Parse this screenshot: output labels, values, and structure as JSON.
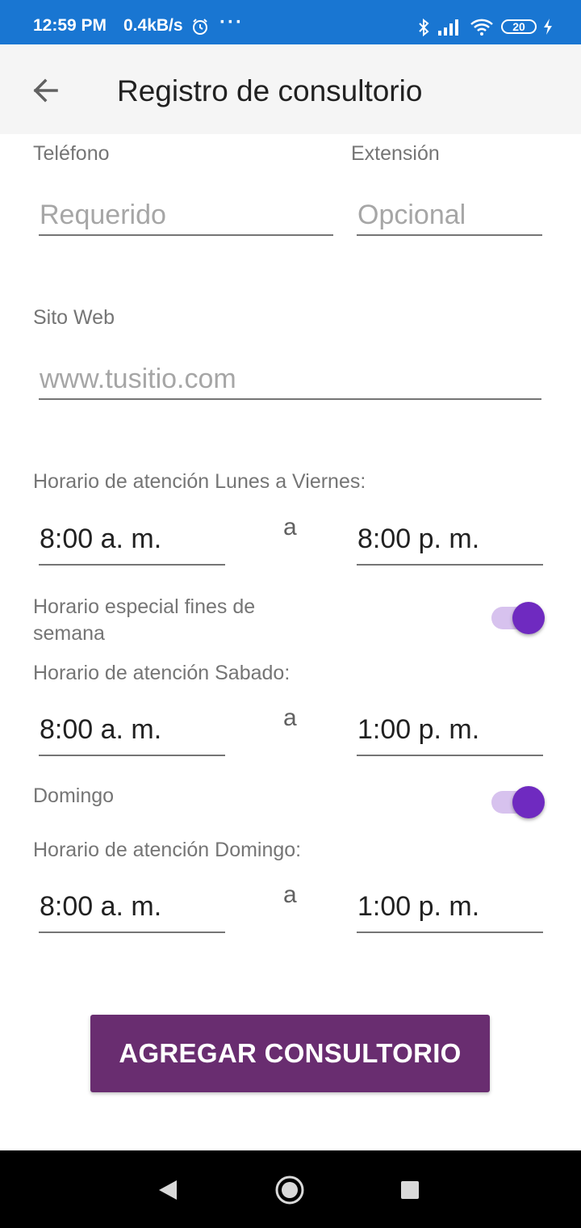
{
  "status_bar": {
    "time": "12:59 PM",
    "network_speed": "0.4kB/s",
    "more": "···",
    "battery": "20"
  },
  "app_bar": {
    "title": "Registro de consultorio",
    "back_icon": "arrow-back-icon"
  },
  "form": {
    "phone": {
      "label": "Teléfono",
      "placeholder": "Requerido"
    },
    "extension": {
      "label": "Extensión",
      "placeholder": "Opcional"
    },
    "website": {
      "label": "Sito Web",
      "placeholder": "www.tusitio.com"
    },
    "weekday": {
      "label": "Horario de atención Lunes a Viernes:",
      "from": "8:00 a. m.",
      "separator": "a",
      "to": "8:00 p. m."
    },
    "weekend_special": {
      "label": "Horario especial fines de semana",
      "enabled": true
    },
    "saturday": {
      "label": "Horario de atención Sabado:",
      "from": "8:00 a. m.",
      "separator": "a",
      "to": "1:00 p. m."
    },
    "sunday_toggle": {
      "label": "Domingo",
      "enabled": true
    },
    "sunday": {
      "label": "Horario de atención Domingo:",
      "from": "8:00 a. m.",
      "separator": "a",
      "to": "1:00 p. m."
    },
    "submit_label": "AGREGAR CONSULTORIO"
  },
  "colors": {
    "status_bar": "#1976d2",
    "accent": "#6f2ac0",
    "button": "#692d70"
  },
  "nav_bar": {
    "icons": [
      "nav-back-icon",
      "nav-home-icon",
      "nav-recents-icon"
    ]
  }
}
